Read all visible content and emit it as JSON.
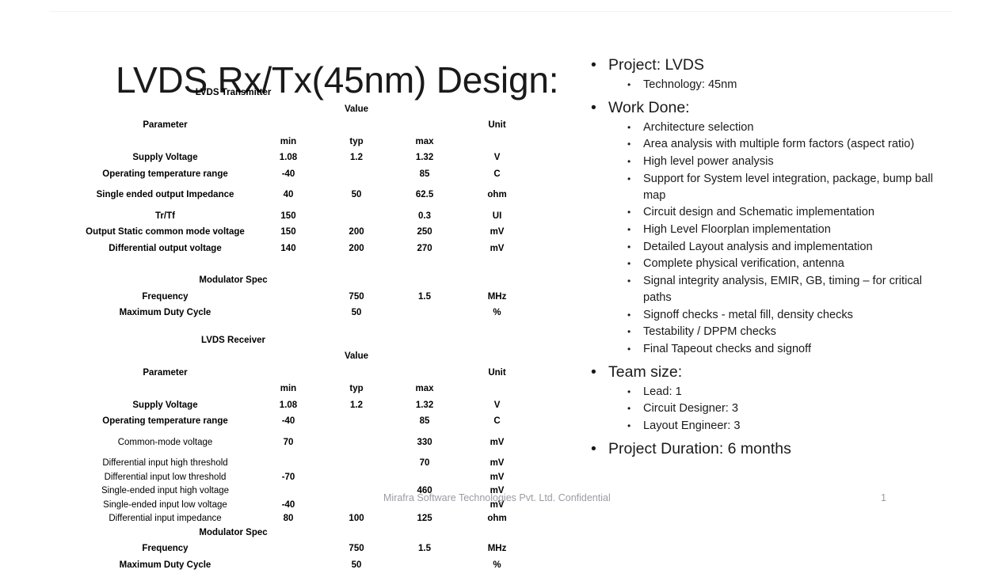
{
  "slide": {
    "title": "LVDS Rx/Tx(45nm) Design:",
    "footer_text": "Mirafra Software Technologies Pvt. Ltd. Confidential",
    "page_number": "1"
  },
  "table": {
    "columns": {
      "parameter": "Parameter",
      "value_group": "Value",
      "min": "min",
      "typ": "typ",
      "max": "max",
      "unit": "Unit"
    },
    "sections": [
      {
        "heading": "LVDS Transmitter",
        "rows": [
          {
            "parameter": "Supply Voltage",
            "min": "1.08",
            "typ": "1.2",
            "max": "1.32",
            "unit": "V",
            "bold_label": true
          },
          {
            "parameter": "Operating temperature range",
            "min": "-40",
            "typ": "",
            "max": "85",
            "unit": "C",
            "bold_label": true
          },
          {
            "parameter": "Single ended output Impedance",
            "min": "40",
            "typ": "50",
            "max": "62.5",
            "unit": "ohm",
            "bold_label": true
          },
          {
            "parameter": "Tr/Tf",
            "min": "150",
            "typ": "",
            "max": "0.3",
            "unit": "UI",
            "bold_label": true
          },
          {
            "parameter": "Output Static common mode voltage",
            "min": "150",
            "typ": "200",
            "max": "250",
            "unit": "mV",
            "bold_label": true
          },
          {
            "parameter": "Differential output voltage",
            "min": "140",
            "typ": "200",
            "max": "270",
            "unit": "mV",
            "bold_label": true
          }
        ]
      },
      {
        "heading": "Modulator Spec",
        "rows": [
          {
            "parameter": "Frequency",
            "min": "",
            "typ": "750",
            "max": "1.5",
            "unit": "MHz",
            "bold_label": true
          },
          {
            "parameter": "Maximum Duty Cycle",
            "min": "",
            "typ": "50",
            "max": "",
            "unit": "%",
            "bold_label": true
          }
        ]
      },
      {
        "heading": "LVDS Receiver",
        "rows": [
          {
            "parameter": "Supply Voltage",
            "min": "1.08",
            "typ": "1.2",
            "max": "1.32",
            "unit": "V",
            "bold_label": true
          },
          {
            "parameter": "Operating temperature range",
            "min": "-40",
            "typ": "",
            "max": "85",
            "unit": "C",
            "bold_label": true
          },
          {
            "parameter": "Common-mode voltage",
            "min": "70",
            "typ": "",
            "max": "330",
            "unit": "mV",
            "bold_label": false
          },
          {
            "parameter": "Differential input high threshold",
            "min": "",
            "typ": "",
            "max": "70",
            "unit": "mV",
            "bold_label": false
          },
          {
            "parameter": "Differential input low threshold",
            "min": "-70",
            "typ": "",
            "max": "",
            "unit": "mV",
            "bold_label": false
          },
          {
            "parameter": "Single-ended input high voltage",
            "min": "",
            "typ": "",
            "max": "460",
            "unit": "mV",
            "bold_label": false
          },
          {
            "parameter": "Single-ended input low voltage",
            "min": "-40",
            "typ": "",
            "max": "",
            "unit": "mV",
            "bold_label": false
          },
          {
            "parameter": "Differential input impedance",
            "min": "80",
            "typ": "100",
            "max": "125",
            "unit": "ohm",
            "bold_label": false
          }
        ]
      },
      {
        "heading": "Modulator Spec",
        "rows": [
          {
            "parameter": "Frequency",
            "min": "",
            "typ": "750",
            "max": "1.5",
            "unit": "MHz",
            "bold_label": true
          },
          {
            "parameter": "Maximum Duty Cycle",
            "min": "",
            "typ": "50",
            "max": "",
            "unit": "%",
            "bold_label": true
          }
        ]
      }
    ]
  },
  "bullets": [
    {
      "level": 1,
      "text": "Project: LVDS",
      "children": [
        {
          "level": 2,
          "text": "Technology: 45nm"
        }
      ]
    },
    {
      "level": 1,
      "text": "Work Done:",
      "children": [
        {
          "level": 2,
          "text": "Architecture selection"
        },
        {
          "level": 2,
          "text": "Area analysis with multiple form factors (aspect ratio)"
        },
        {
          "level": 2,
          "text": "High level power analysis"
        },
        {
          "level": 2,
          "text": "Support for System level integration, package, bump ball map"
        },
        {
          "level": 2,
          "text": "Circuit design and Schematic implementation"
        },
        {
          "level": 2,
          "text": "High Level Floorplan implementation"
        },
        {
          "level": 2,
          "text": "Detailed Layout analysis and implementation"
        },
        {
          "level": 2,
          "text": "Complete physical verification, antenna"
        },
        {
          "level": 2,
          "text": "Signal integrity analysis, EMIR, GB, timing – for critical paths"
        },
        {
          "level": 2,
          "text": "Signoff checks  - metal fill, density checks"
        },
        {
          "level": 2,
          "text": "Testability / DPPM checks"
        },
        {
          "level": 2,
          "text": "Final Tapeout checks and signoff"
        }
      ]
    },
    {
      "level": 1,
      "text": "Team size:",
      "children": [
        {
          "level": 2,
          "text": "Lead: 1"
        },
        {
          "level": 2,
          "text": "Circuit Designer: 3"
        },
        {
          "level": 2,
          "text": "Layout Engineer: 3"
        }
      ]
    },
    {
      "level": 1,
      "text": "Project Duration: 6 months",
      "children": []
    }
  ],
  "icons": {
    "bullet_marker": "•"
  },
  "colors": {
    "text": "#1a1a1a",
    "table_text": "#000000",
    "footer_text": "#9b9ba3",
    "rule": "#f4f4f5",
    "background": "#ffffff"
  }
}
